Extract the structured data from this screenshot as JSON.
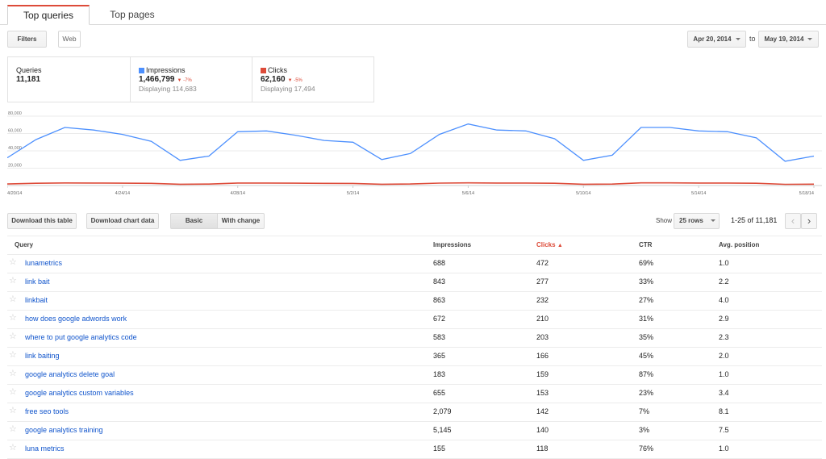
{
  "tabs": [
    {
      "label": "Top queries",
      "active": true
    },
    {
      "label": "Top pages",
      "active": false
    }
  ],
  "filters_label": "Filters",
  "search_type": "Web",
  "date_from": "Apr 20, 2014",
  "date_to": "May 19, 2014",
  "to_label": "to",
  "summary": {
    "queries_title": "Queries",
    "queries_value": "11,181",
    "impressions_title": "Impressions",
    "impressions_value": "1,466,799",
    "impressions_delta": "-7%",
    "impressions_sub": "Displaying 114,683",
    "clicks_title": "Clicks",
    "clicks_value": "62,160",
    "clicks_delta": "-5%",
    "clicks_sub": "Displaying 17,494"
  },
  "colors": {
    "impressions": "#4d90fe",
    "clicks": "#dd4b39",
    "accent": "#dd4b39",
    "link": "#1155cc"
  },
  "chart_data": {
    "type": "line",
    "y_ticks": [
      "80,000",
      "60,000",
      "40,000",
      "20,000"
    ],
    "ylim": [
      0,
      80000
    ],
    "x_tick_labels": [
      "4/20/14",
      "4/24/14",
      "4/28/14",
      "5/2/14",
      "5/6/14",
      "5/10/14",
      "5/14/14",
      "5/18/14"
    ],
    "x_tick_days": [
      0,
      4,
      8,
      12,
      16,
      20,
      24,
      28
    ],
    "series": [
      {
        "name": "Impressions",
        "color": "#4d90fe",
        "values": [
          32000,
          53000,
          67000,
          64000,
          59000,
          51000,
          29000,
          34000,
          62000,
          63000,
          58000,
          52000,
          50000,
          30000,
          37000,
          59000,
          71000,
          64000,
          63000,
          54000,
          29000,
          35000,
          67000,
          67000,
          63000,
          62000,
          55000,
          28000,
          34000
        ]
      },
      {
        "name": "Clicks",
        "color": "#dd4b39",
        "values": [
          1800,
          2600,
          3000,
          2900,
          2700,
          2500,
          1500,
          1700,
          2900,
          2900,
          2700,
          2500,
          2400,
          1500,
          1800,
          2800,
          3100,
          2900,
          2900,
          2600,
          1500,
          1700,
          3100,
          3100,
          2900,
          2900,
          2600,
          1400,
          1600
        ]
      }
    ]
  },
  "buttons": {
    "download_table": "Download this table",
    "download_chart": "Download chart data",
    "basic": "Basic",
    "with_change": "With change"
  },
  "show_label": "Show",
  "rows_option": "25 rows",
  "pager": "1-25 of 11,181",
  "columns": {
    "query": "Query",
    "impressions": "Impressions",
    "clicks": "Clicks",
    "ctr": "CTR",
    "position": "Avg. position"
  },
  "rows": [
    {
      "query": "lunametrics",
      "impressions": "688",
      "clicks": "472",
      "ctr": "69%",
      "position": "1.0"
    },
    {
      "query": "link bait",
      "impressions": "843",
      "clicks": "277",
      "ctr": "33%",
      "position": "2.2"
    },
    {
      "query": "linkbait",
      "impressions": "863",
      "clicks": "232",
      "ctr": "27%",
      "position": "4.0"
    },
    {
      "query": "how does google adwords work",
      "impressions": "672",
      "clicks": "210",
      "ctr": "31%",
      "position": "2.9"
    },
    {
      "query": "where to put google analytics code",
      "impressions": "583",
      "clicks": "203",
      "ctr": "35%",
      "position": "2.3"
    },
    {
      "query": "link baiting",
      "impressions": "365",
      "clicks": "166",
      "ctr": "45%",
      "position": "2.0"
    },
    {
      "query": "google analytics delete goal",
      "impressions": "183",
      "clicks": "159",
      "ctr": "87%",
      "position": "1.0"
    },
    {
      "query": "google analytics custom variables",
      "impressions": "655",
      "clicks": "153",
      "ctr": "23%",
      "position": "3.4"
    },
    {
      "query": "free seo tools",
      "impressions": "2,079",
      "clicks": "142",
      "ctr": "7%",
      "position": "8.1"
    },
    {
      "query": "google analytics training",
      "impressions": "5,145",
      "clicks": "140",
      "ctr": "3%",
      "position": "7.5"
    },
    {
      "query": "luna metrics",
      "impressions": "155",
      "clicks": "118",
      "ctr": "76%",
      "position": "1.0"
    }
  ]
}
